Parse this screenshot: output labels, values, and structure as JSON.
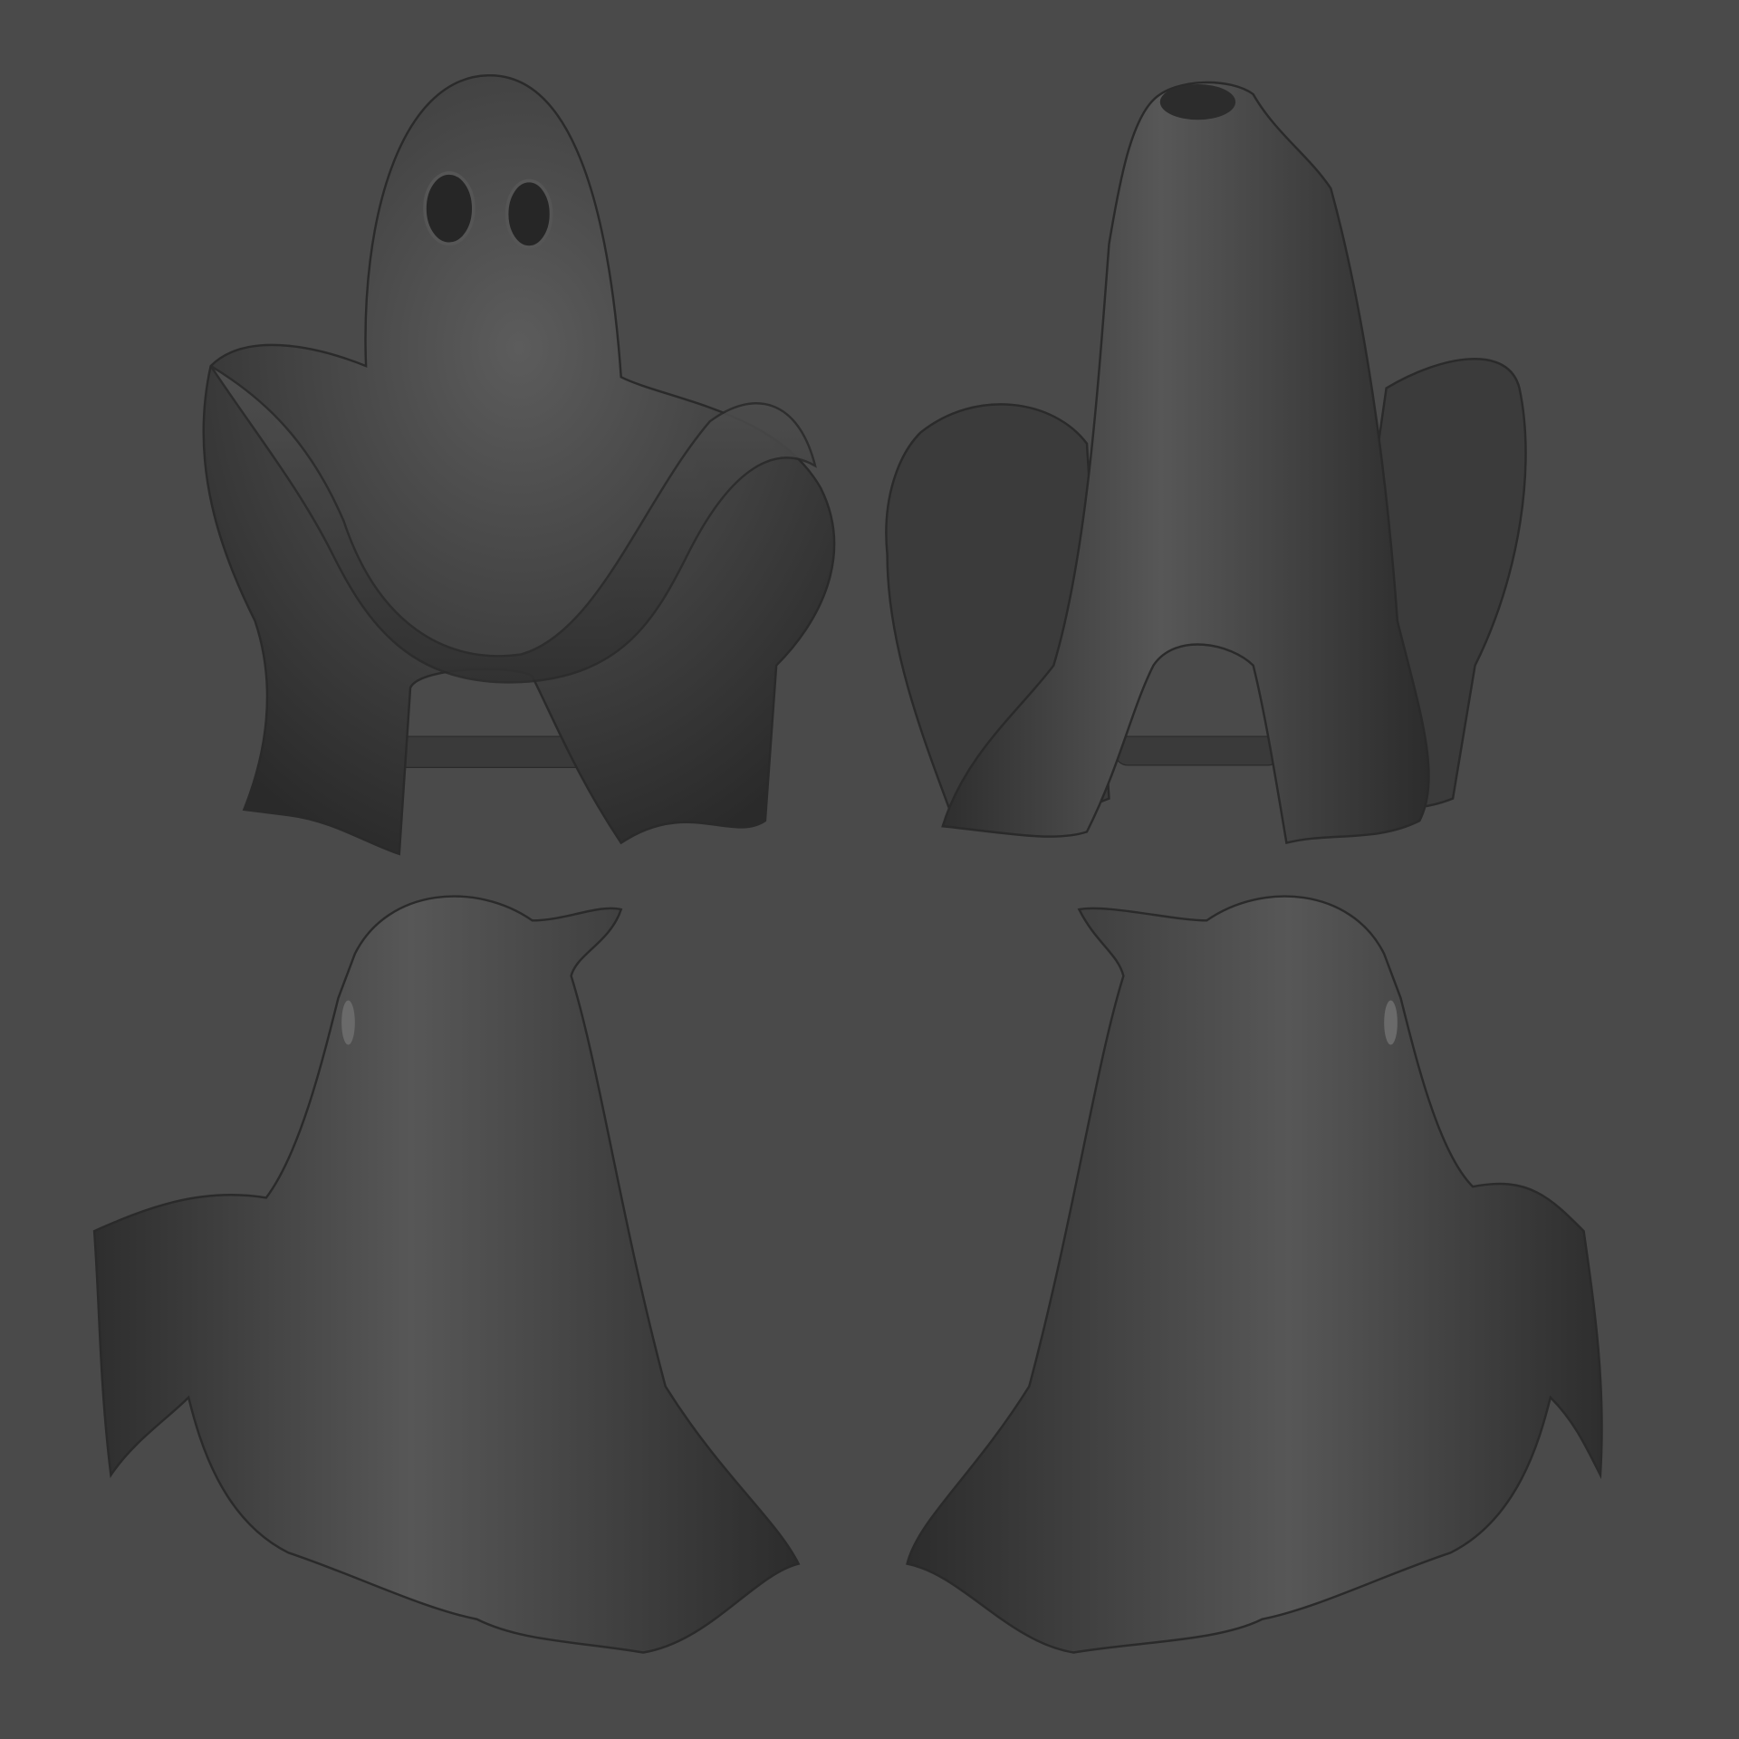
{
  "colors": {
    "background": "#4a4a4a",
    "ghost_base": "#3a3a3a",
    "ghost_highlight": "#5e5e5e",
    "ghost_shadow": "#262626"
  }
}
